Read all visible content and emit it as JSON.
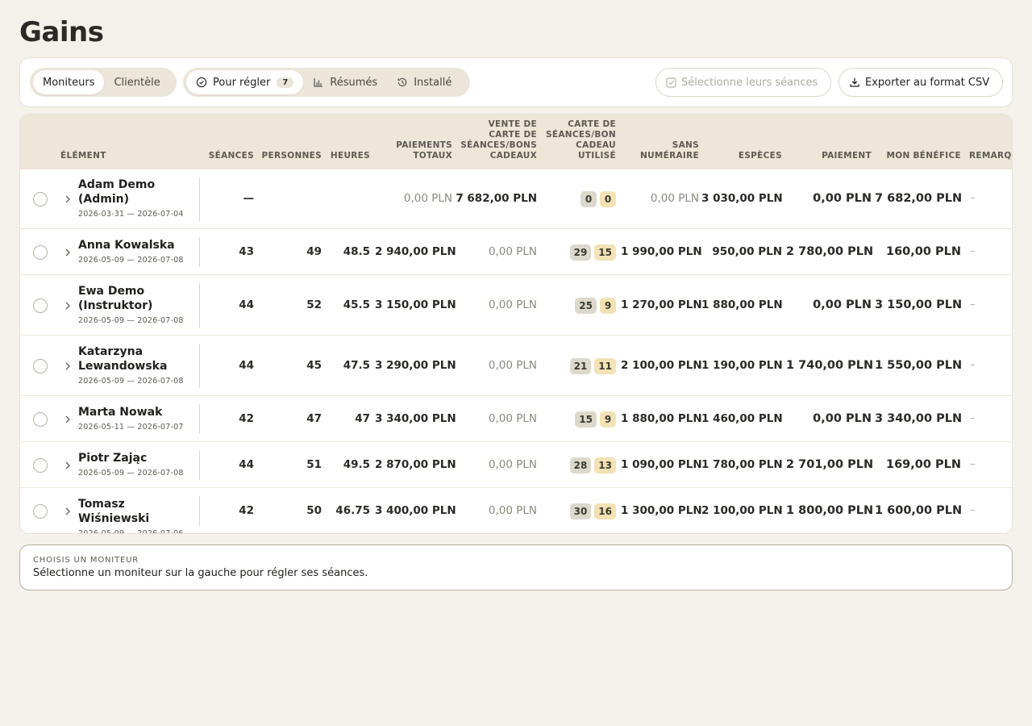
{
  "page": {
    "title": "Gains"
  },
  "toolbar": {
    "view_tabs": [
      {
        "label": "Moniteurs",
        "active": true
      },
      {
        "label": "Clientèle",
        "active": false
      }
    ],
    "status_tabs": [
      {
        "label": "Pour régler",
        "count": "7",
        "icon": "check-circle-icon",
        "active": true
      },
      {
        "label": "Résumés",
        "icon": "bar-chart-icon",
        "active": false
      },
      {
        "label": "Installé",
        "icon": "history-icon",
        "active": false
      }
    ],
    "select_sessions_label": "Sélectionne leurs séances",
    "export_label": "Exporter au format CSV"
  },
  "table": {
    "headers": {
      "element": "ÉLÉMENT",
      "seances": "SÉANCES",
      "personnes": "PERSONNES",
      "heures": "HEURES",
      "paiements_totaux": "PAIEMENTS TOTAUX",
      "vente_carte": "VENTE DE CARTE DE SÉANCES/BONS CADEAUX",
      "carte_utilise": "CARTE DE SÉANCES/BON CADEAU UTILISÉ",
      "sans_numeraire": "SANS NUMÉRAIRE",
      "especes": "ESPÈCES",
      "paiement": "PAIEMENT",
      "mon_benefice": "MON BÉNÉFICE",
      "remarque": "REMARQ"
    },
    "rows": [
      {
        "name": "Adam Demo (Admin)",
        "dates": "2026-03-31 — 2026-07-04",
        "seances": "—",
        "personnes": "",
        "heures": "",
        "paiements_totaux": "0,00 PLN",
        "vente_carte": "7 682,00 PLN",
        "pill_a": "0",
        "pill_b": "0",
        "sans_numeraire": "0,00 PLN",
        "especes": "3 030,00 PLN",
        "paiement": "0,00 PLN",
        "mon_benefice": "7 682,00 PLN",
        "remarque": "–"
      },
      {
        "name": "Anna Kowalska",
        "dates": "2026-05-09 — 2026-07-08",
        "seances": "43",
        "personnes": "49",
        "heures": "48.5",
        "paiements_totaux": "2 940,00 PLN",
        "vente_carte": "0,00 PLN",
        "pill_a": "29",
        "pill_b": "15",
        "sans_numeraire": "1 990,00 PLN",
        "especes": "950,00 PLN",
        "paiement": "2 780,00 PLN",
        "mon_benefice": "160,00 PLN",
        "remarque": "–"
      },
      {
        "name": "Ewa Demo (Instruktor)",
        "dates": "2026-05-09 — 2026-07-08",
        "seances": "44",
        "personnes": "52",
        "heures": "45.5",
        "paiements_totaux": "3 150,00 PLN",
        "vente_carte": "0,00 PLN",
        "pill_a": "25",
        "pill_b": "9",
        "sans_numeraire": "1 270,00 PLN",
        "especes": "1 880,00 PLN",
        "paiement": "0,00 PLN",
        "mon_benefice": "3 150,00 PLN",
        "remarque": "–"
      },
      {
        "name": "Katarzyna Lewandowska",
        "dates": "2026-05-09 — 2026-07-08",
        "seances": "44",
        "personnes": "45",
        "heures": "47.5",
        "paiements_totaux": "3 290,00 PLN",
        "vente_carte": "0,00 PLN",
        "pill_a": "21",
        "pill_b": "11",
        "sans_numeraire": "2 100,00 PLN",
        "especes": "1 190,00 PLN",
        "paiement": "1 740,00 PLN",
        "mon_benefice": "1 550,00 PLN",
        "remarque": "–"
      },
      {
        "name": "Marta Nowak",
        "dates": "2026-05-11 — 2026-07-07",
        "seances": "42",
        "personnes": "47",
        "heures": "47",
        "paiements_totaux": "3 340,00 PLN",
        "vente_carte": "0,00 PLN",
        "pill_a": "15",
        "pill_b": "9",
        "sans_numeraire": "1 880,00 PLN",
        "especes": "1 460,00 PLN",
        "paiement": "0,00 PLN",
        "mon_benefice": "3 340,00 PLN",
        "remarque": "–"
      },
      {
        "name": "Piotr Zając",
        "dates": "2026-05-09 — 2026-07-08",
        "seances": "44",
        "personnes": "51",
        "heures": "49.5",
        "paiements_totaux": "2 870,00 PLN",
        "vente_carte": "0,00 PLN",
        "pill_a": "28",
        "pill_b": "13",
        "sans_numeraire": "1 090,00 PLN",
        "especes": "1 780,00 PLN",
        "paiement": "2 701,00 PLN",
        "mon_benefice": "169,00 PLN",
        "remarque": "–"
      },
      {
        "name": "Tomasz Wiśniewski",
        "dates": "2026-05-09 — 2026-07-06",
        "seances": "42",
        "personnes": "50",
        "heures": "46.75",
        "paiements_totaux": "3 400,00 PLN",
        "vente_carte": "0,00 PLN",
        "pill_a": "30",
        "pill_b": "16",
        "sans_numeraire": "1 300,00 PLN",
        "especes": "2 100,00 PLN",
        "paiement": "1 800,00 PLN",
        "mon_benefice": "1 600,00 PLN",
        "remarque": "–"
      }
    ]
  },
  "choose": {
    "title": "CHOISIS UN MONITEUR",
    "text": "Sélectionne un moniteur sur la gauche pour régler ses séances."
  }
}
